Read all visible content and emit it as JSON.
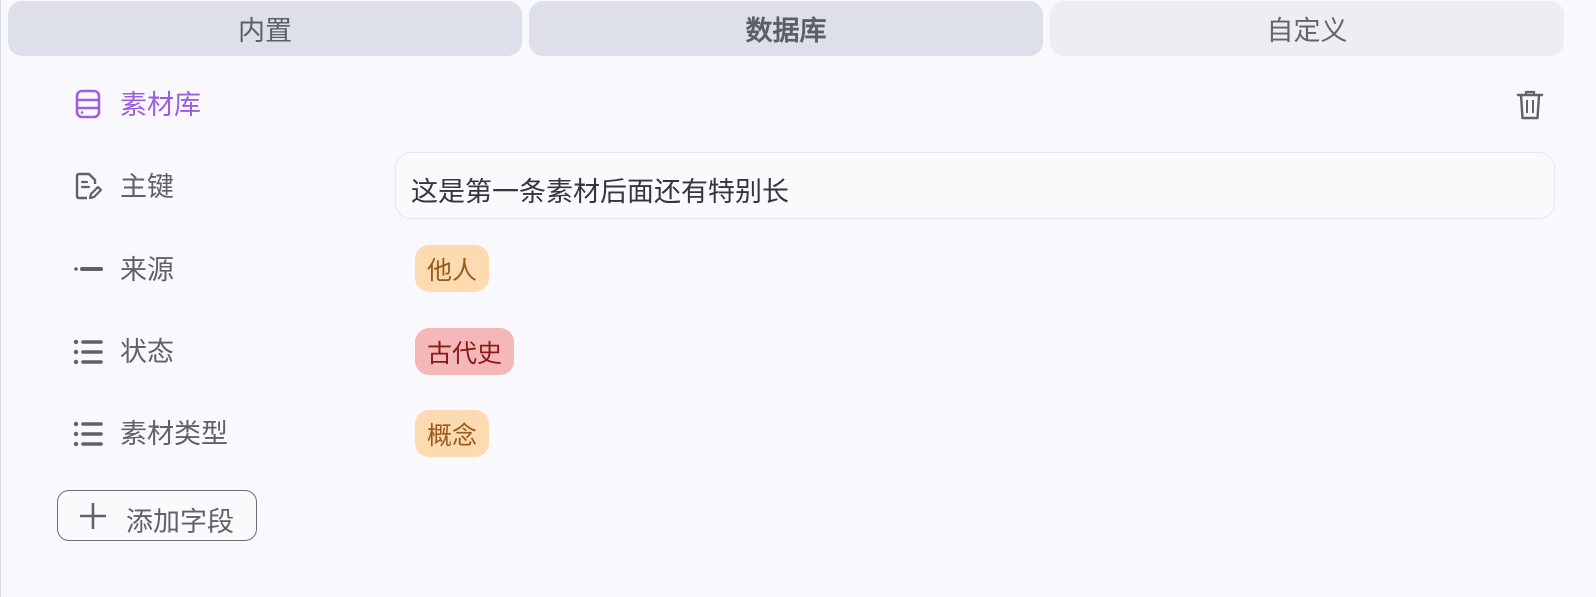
{
  "tabs": [
    {
      "label": "内置"
    },
    {
      "label": "数据库"
    },
    {
      "label": "自定义"
    }
  ],
  "database": {
    "name": "素材库",
    "accent": "#9b5fe0"
  },
  "fields": {
    "primary_key": {
      "label": "主键",
      "value": "这是第一条素材后面还有特别长"
    },
    "source": {
      "label": "来源",
      "tag": "他人",
      "tag_bg": "#fddbb0",
      "tag_color": "#9a5a1c"
    },
    "status": {
      "label": "状态",
      "tag": "古代史",
      "tag_bg": "#f4b8b8",
      "tag_color": "#8a1a1a"
    },
    "material_type": {
      "label": "素材类型",
      "tag": "概念",
      "tag_bg": "#fddbb0",
      "tag_color": "#9a5a1c"
    }
  },
  "add_field": {
    "label": "添加字段"
  },
  "icons": {
    "database": "database-icon",
    "trash": "trash-icon",
    "primary_key": "document-edit-icon",
    "source": "line-dash-icon",
    "status": "list-icon",
    "material_type": "list-icon",
    "add": "plus-icon"
  }
}
